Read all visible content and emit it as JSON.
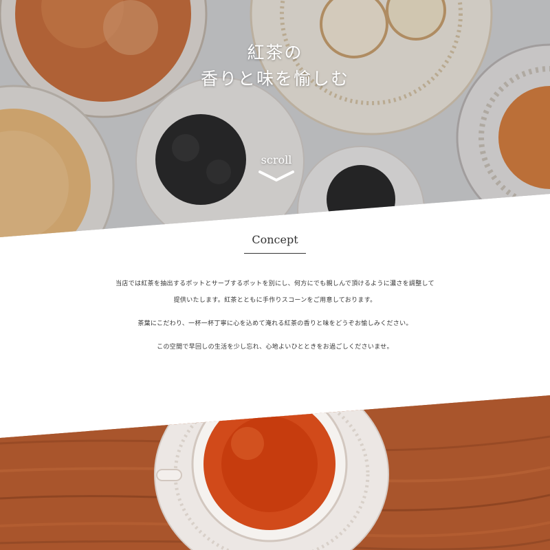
{
  "hero": {
    "title_line1": "紅茶の",
    "title_line2": "香りと味を愉しむ",
    "scroll_label": "scroll"
  },
  "concept": {
    "heading": "Concept",
    "paragraphs": [
      "当店では紅茶を抽出するポットとサーブするポットを別にし、何方にでも親しんで頂けるように濃さを調整して提供いたします。紅茶とともに手作りスコーンをご用意しております。",
      "茶葉にこだわり、一杯一杯丁寧に心を込めて淹れる紅茶の香りと味をどうぞお愉しみください。",
      "この空間で早回しの生活を少し忘れ、心地よいひとときをお過ごしくださいませ。"
    ]
  },
  "colors": {
    "accent_text": "#333333",
    "wood": "#a7542b",
    "tea": "#c83a0d"
  },
  "icons": {
    "scroll": "chevron-down-icon"
  }
}
